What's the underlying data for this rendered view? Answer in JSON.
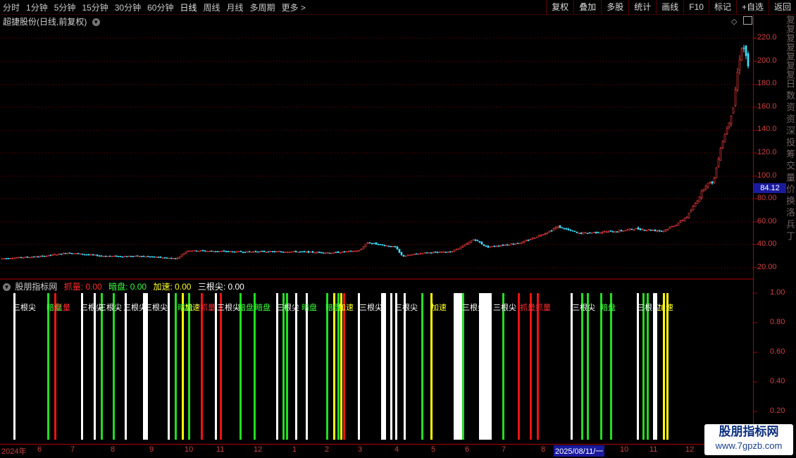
{
  "toolbar": {
    "timeframes": [
      "分时",
      "1分钟",
      "5分钟",
      "15分钟",
      "30分钟",
      "60分钟",
      "日线",
      "周线",
      "月线",
      "多周期",
      "更多 >"
    ],
    "active": "日线",
    "actions": [
      "复权",
      "叠加",
      "多股",
      "统计",
      "画线",
      "F10",
      "标记",
      "+自选",
      "返回"
    ]
  },
  "chart_title": "超捷股份(日线,前复权)",
  "price_axis": [
    "220.0",
    "200.0",
    "180.0",
    "160.0",
    "140.0",
    "120.0",
    "100.0",
    "80.00",
    "60.00",
    "40.00",
    "20.00"
  ],
  "current_price": "84.12",
  "indicator": {
    "name": "股朋指标网",
    "values": [
      {
        "label": "抓量: 0.00",
        "color": "#ff2d2d"
      },
      {
        "label": "暗盘: 0.00",
        "color": "#3cff3c"
      },
      {
        "label": "加速: 0.00",
        "color": "#ffff2d"
      },
      {
        "label": "三根尖: 0.00",
        "color": "#ffffff"
      }
    ],
    "axis": [
      "1.00",
      "0.80",
      "0.60",
      "0.40",
      "0.20"
    ]
  },
  "signal_labels": [
    "三根尖",
    "抓量",
    "暗盘",
    "加速"
  ],
  "date_axis": [
    {
      "label": "2024年",
      "hl": false
    },
    {
      "label": "6",
      "hl": false
    },
    {
      "label": "7",
      "hl": false
    },
    {
      "label": "8",
      "hl": false
    },
    {
      "label": "9",
      "hl": false
    },
    {
      "label": "10",
      "hl": false
    },
    {
      "label": "11",
      "hl": false
    },
    {
      "label": "12",
      "hl": false
    },
    {
      "label": "1",
      "hl": false
    },
    {
      "label": "2",
      "hl": false
    },
    {
      "label": "3",
      "hl": false
    },
    {
      "label": "4",
      "hl": false
    },
    {
      "label": "5",
      "hl": false
    },
    {
      "label": "6",
      "hl": false
    },
    {
      "label": "7",
      "hl": false
    },
    {
      "label": "8",
      "hl": false
    },
    {
      "label": "2025/08/11/一",
      "hl": true
    },
    {
      "label": "10",
      "hl": false
    },
    {
      "label": "11",
      "hl": false
    },
    {
      "label": "12",
      "hl": false
    }
  ],
  "side_text": "复复复复复复复日 数 资 资 深 投 筹 交 量 价 换 洛 兵 丁",
  "watermark": {
    "line1": "股朋指标网",
    "line2": "www.7gpzb.com"
  },
  "colors": {
    "up": "#ff4040",
    "down": "#40e0ff",
    "grid": "#7a0000",
    "signal_white": "#ffffff",
    "signal_green": "#22dd22",
    "signal_red": "#ee1111",
    "signal_yellow": "#ffff00"
  }
}
